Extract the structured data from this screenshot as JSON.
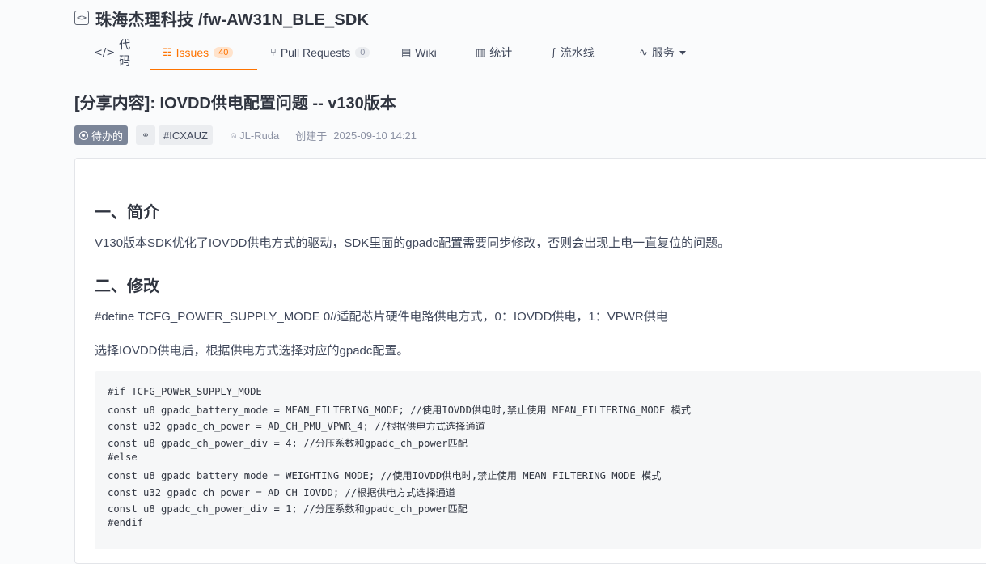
{
  "repo": {
    "title": "珠海杰理科技 /fw-AW31N_BLE_SDK"
  },
  "tabs": [
    {
      "label": "代码"
    },
    {
      "label": "Issues",
      "count": "40"
    },
    {
      "label": "Pull Requests",
      "count": "0"
    },
    {
      "label": "Wiki"
    },
    {
      "label": "统计"
    },
    {
      "label": "流水线"
    },
    {
      "label": "服务"
    }
  ],
  "issue": {
    "title": "[分享内容]: IOVDD供电配置问题 -- v130版本",
    "status": "待办的",
    "id": "#ICXAUZ",
    "author": "JL-Ruda",
    "created_label": "创建于",
    "created_time": "2025-09-10 14:21"
  },
  "body": {
    "h1": "一、简介",
    "p1": "V130版本SDK优化了IOVDD供电方式的驱动，SDK里面的gpadc配置需要同步修改，否则会出现上电一直复位的问题。",
    "h2": "二、修改",
    "p2": "#define TCFG_POWER_SUPPLY_MODE 0//适配芯片硬件电路供电方式，0：IOVDD供电，1：VPWR供电",
    "p3": "选择IOVDD供电后，根据供电方式选择对应的gpadc配置。",
    "code": [
      "#if TCFG_POWER_SUPPLY_MODE",
      "const u8 gpadc_battery_mode = MEAN_FILTERING_MODE; //使用IOVDD供电时,禁止使用 MEAN_FILTERING_MODE 模式",
      "const u32 gpadc_ch_power = AD_CH_PMU_VPWR_4; //根据供电方式选择通道",
      "const u8 gpadc_ch_power_div = 4; //分压系数和gpadc_ch_power匹配",
      "#else",
      "const u8 gpadc_battery_mode = WEIGHTING_MODE; //使用IOVDD供电时,禁止使用 MEAN_FILTERING_MODE 模式",
      "const u32 gpadc_ch_power = AD_CH_IOVDD; //根据供电方式选择通道",
      "const u8 gpadc_ch_power_div = 1; //分压系数和gpadc_ch_power匹配",
      "#endif"
    ]
  },
  "colors": {
    "accent": "#fe7300",
    "status_bg": "#7b8598",
    "code_bg": "#f6f7f8"
  }
}
